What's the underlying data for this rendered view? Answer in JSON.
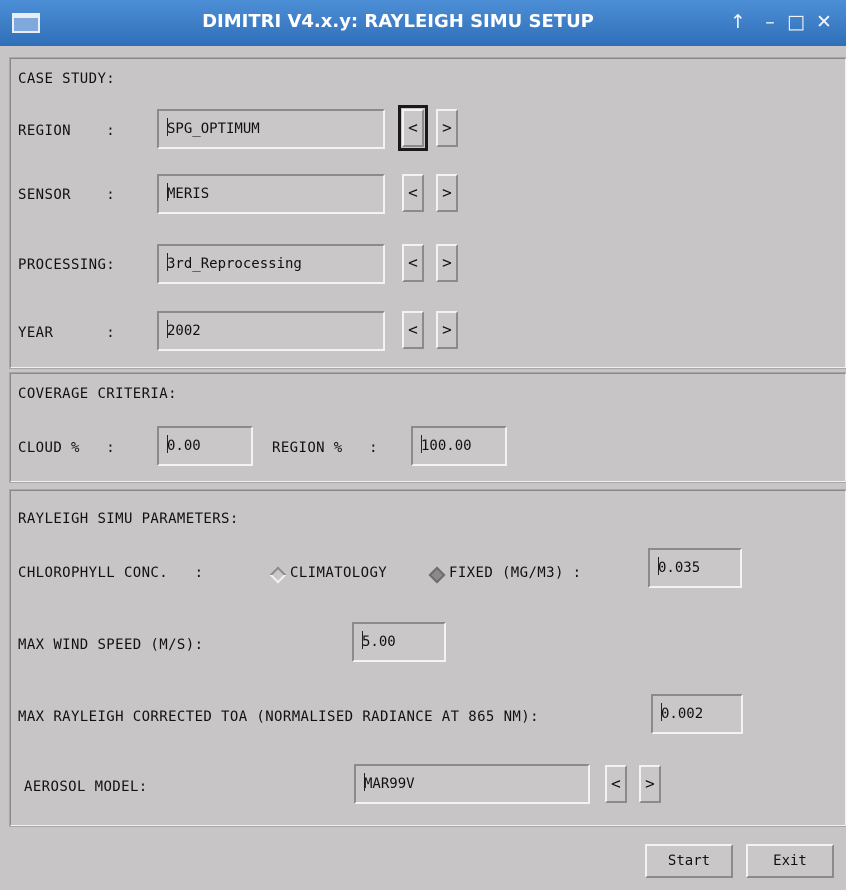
{
  "window": {
    "title": "DIMITRI V4.x.y: RAYLEIGH SIMU SETUP",
    "controls": {
      "up": "↑",
      "minimize": "–",
      "maximize": "□",
      "close": "✕"
    }
  },
  "case_study": {
    "title": "CASE STUDY:",
    "region": {
      "label": "REGION    :",
      "value": "SPG_OPTIMUM"
    },
    "sensor": {
      "label": "SENSOR    :",
      "value": "MERIS"
    },
    "processing": {
      "label": "PROCESSING:",
      "value": "3rd_Reprocessing"
    },
    "year": {
      "label": "YEAR      :",
      "value": "2002"
    },
    "prev": "<",
    "next": ">"
  },
  "coverage": {
    "title": "COVERAGE CRITERIA:",
    "cloud": {
      "label": "CLOUD %   :",
      "value": "0.00"
    },
    "region": {
      "label": "REGION %   :",
      "value": "100.00"
    }
  },
  "rayleigh": {
    "title": "RAYLEIGH SIMU PARAMETERS:",
    "chlorophyll": {
      "label": "CHLOROPHYLL CONC.   :",
      "option_climatology": "CLIMATOLOGY",
      "option_fixed": "FIXED (MG/M3) :",
      "selected": "fixed",
      "value": "0.035"
    },
    "wind": {
      "label": "MAX WIND SPEED (M/S):",
      "value": "5.00"
    },
    "toa": {
      "label": "MAX RAYLEIGH CORRECTED TOA (NORMALISED RADIANCE AT 865 NM):",
      "value": "0.002"
    },
    "aerosol": {
      "label": "AEROSOL MODEL:",
      "value": "MAR99V",
      "prev": "<",
      "next": ">"
    }
  },
  "buttons": {
    "start": "Start",
    "exit": "Exit"
  },
  "colors": {
    "titlebar": "#3a7cc7",
    "background": "#c8c5c6"
  }
}
